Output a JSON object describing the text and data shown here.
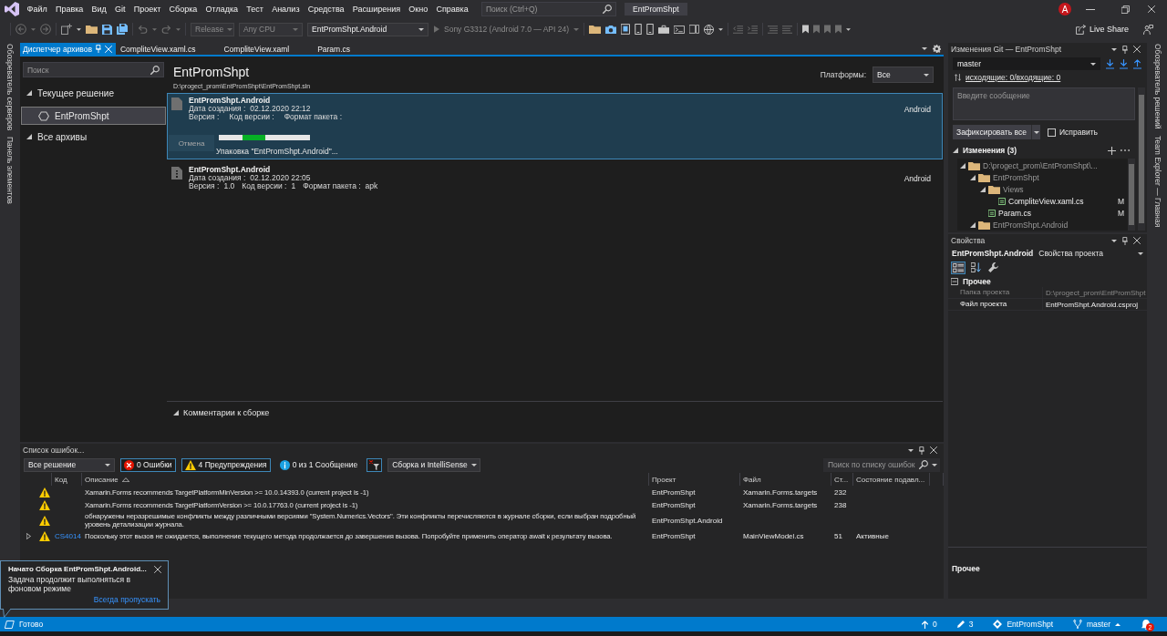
{
  "title_bar": {
    "menu": [
      "Файл",
      "Правка",
      "Вид",
      "Git",
      "Проект",
      "Сборка",
      "Отладка",
      "Тест",
      "Анализ",
      "Средства",
      "Расширения",
      "Окно",
      "Справка"
    ],
    "search": {
      "placeholder": "Поиск (Ctrl+Q)"
    },
    "solution_name": "EntPromShpt",
    "account_initial": "A"
  },
  "toolbar": {
    "left_groups": [
      [
        {
          "kind": "back",
          "disabled": true
        },
        {
          "kind": "dropdown",
          "disabled": true
        },
        {
          "kind": "forward",
          "disabled": true
        }
      ],
      [
        {
          "kind": "new_item",
          "disabled": false
        },
        {
          "kind": "dropdown",
          "disabled": false
        },
        {
          "kind": "open",
          "disabled": false
        },
        {
          "kind": "save",
          "disabled": false
        },
        {
          "kind": "save_all",
          "disabled": false
        }
      ],
      [
        {
          "kind": "undo",
          "disabled": true
        },
        {
          "kind": "dropdown",
          "disabled": true
        },
        {
          "kind": "redo",
          "disabled": true
        },
        {
          "kind": "dropdown",
          "disabled": true
        }
      ]
    ],
    "configuration": {
      "value": "Release",
      "disabled": true
    },
    "platform": {
      "value": "Any CPU",
      "disabled": true
    },
    "startup_project": {
      "value": "EntPromShpt.Android",
      "disabled": false
    },
    "device": {
      "label": "Sony G3312 (Android 7.0 — API 24)",
      "disabled": true
    },
    "right_groups": [
      [
        {
          "kind": "open",
          "disabled": false
        },
        {
          "kind": "camera",
          "disabled": false
        },
        {
          "kind": "tablet",
          "disabled": false
        },
        {
          "kind": "phone",
          "disabled": false
        },
        {
          "kind": "phone",
          "disabled": false
        },
        {
          "kind": "toolbox",
          "disabled": false
        },
        {
          "kind": "terminal",
          "disabled": false
        },
        {
          "kind": "panels",
          "disabled": false
        },
        {
          "kind": "globe",
          "disabled": false
        },
        {
          "kind": "dropdown",
          "disabled": false
        }
      ],
      [
        {
          "kind": "outdent",
          "disabled": true
        },
        {
          "kind": "indent",
          "disabled": true
        }
      ],
      [
        {
          "kind": "comment",
          "disabled": true
        },
        {
          "kind": "uncomment",
          "disabled": true
        }
      ],
      [
        {
          "kind": "bookmark",
          "disabled": false
        },
        {
          "kind": "bookmark",
          "disabled": true
        },
        {
          "kind": "bookmark",
          "disabled": true
        },
        {
          "kind": "bookmark",
          "disabled": true
        },
        {
          "kind": "dropdown",
          "disabled": false
        }
      ]
    ],
    "live_share": "Live Share"
  },
  "left_strip": [
    {
      "label": "Обозреватель серверов"
    },
    {
      "label": "Панель элементов"
    }
  ],
  "document_tabs": [
    {
      "label": "Диспетчер архивов",
      "selected": true
    },
    {
      "label": "CompliteView.xaml.cs",
      "selected": false
    },
    {
      "label": "CompliteView.xaml",
      "selected": false
    },
    {
      "label": "Param.cs",
      "selected": false
    }
  ],
  "archive_manager": {
    "search": {
      "placeholder": "Поиск"
    },
    "tree": [
      {
        "label": "Текущее решение",
        "expanded": true,
        "selected": false,
        "children": [
          {
            "label": "EntPromShpt",
            "selected": true
          }
        ]
      },
      {
        "label": "Все архивы",
        "expanded": true,
        "selected": false
      }
    ],
    "solution": {
      "name": "EntPromShpt",
      "path": "D:\\progect_prom\\EntPromShpt\\EntPromShpt.sln"
    },
    "platforms": {
      "label": "Платформы:",
      "value": "Все"
    },
    "archives": [
      {
        "kind": "pending",
        "selected": true,
        "name": "EntPromShpt.Android",
        "created": {
          "label": "Дата создания :",
          "value": "02.12.2020 22:12"
        },
        "fields": [
          {
            "label": "Версия :"
          },
          {
            "label": "Код версии :"
          },
          {
            "label": "Формат пакета :"
          }
        ],
        "platform": "Android",
        "progress": {
          "cancel": "Отмена",
          "indeterminate": true,
          "status": "Упаковка \"EntPromShpt.Android\"..."
        }
      },
      {
        "kind": "archive",
        "selected": false,
        "name": "EntPromShpt.Android",
        "created": {
          "label": "Дата создания :",
          "value": "02.12.2020 22:05"
        },
        "fields": [
          {
            "label": "Версия :",
            "value": "1.0"
          },
          {
            "label": "Код версии :",
            "value": "1"
          },
          {
            "label": "Формат пакета :",
            "value": "apk"
          }
        ],
        "platform": "Android"
      }
    ],
    "comments": {
      "label": "Комментарии к сборке",
      "expanded": true
    }
  },
  "error_list": {
    "title": "Список ошибок...",
    "scope": "Все решение",
    "filters": [
      {
        "kind": "error",
        "label": "0 Ошибки",
        "selected": true
      },
      {
        "kind": "warning",
        "label": "4 Предупреждения",
        "selected": true
      },
      {
        "kind": "info",
        "label": "0 из 1 Сообщение",
        "selected": false
      }
    ],
    "project_filter": {
      "selected": true
    },
    "source": "Сборка и IntelliSense",
    "search": {
      "placeholder": "Поиск по списку ошибок"
    },
    "columns": [
      {
        "label": "Код",
        "sorted_ascending": false
      },
      {
        "label": "Описание",
        "sorted_ascending": true
      },
      {
        "label": "Проект",
        "sorted_ascending": false
      },
      {
        "label": "Файл",
        "sorted_ascending": false
      },
      {
        "label": "Ст...",
        "sorted_ascending": false
      },
      {
        "label": "Состояние подавл...",
        "sorted_ascending": false
      }
    ],
    "rows": [
      {
        "kind": "warning",
        "expandable": false,
        "description": "Xamarin.Forms recommends TargetPlatformMinVersion >= 10.0.14393.0 (current project is -1)",
        "project": "EntPromShpt",
        "file": "Xamarin.Forms.targets",
        "line": "232"
      },
      {
        "kind": "warning",
        "expandable": false,
        "description": "Xamarin.Forms recommends TargetPlatformVersion >= 10.0.17763.0 (current project is -1)",
        "project": "EntPromShpt",
        "file": "Xamarin.Forms.targets",
        "line": "238"
      },
      {
        "kind": "warning",
        "expandable": false,
        "description": "обнаружены неразрешимые конфликты между различными версиями \"System.Numerics.Vectors\". Эти конфликты перечисляются в журнале сборки, если выбран подробный уровень детализации журнала.",
        "project": "EntPromShpt.Android"
      },
      {
        "kind": "warning",
        "expandable": true,
        "code": "CS4014",
        "description": "Поскольку этот вызов не ожидается, выполнение текущего метода продолжается до завершения вызова. Попробуйте применить оператор await к результату вызова.",
        "project": "EntPromShpt",
        "file": "MainViewModel.cs",
        "line": "51",
        "state": "Активные"
      }
    ]
  },
  "toast": {
    "title": "Начато Сборка EntPromShpt.Android...",
    "body": "Задача продолжит выполняться в фоновом режиме",
    "link": "Всегда пропускать"
  },
  "git_changes": {
    "title": "Изменения Git — EntPromShpt",
    "branch": "master",
    "sync_link": "исходящие: 0/входящие: 0",
    "message": {
      "placeholder": "Введите сообщение"
    },
    "commit_button": "Зафиксировать все",
    "amend": {
      "label": "Исправить",
      "checked": false
    },
    "changes": {
      "label": "Изменения (3)",
      "expanded": true,
      "tree": [
        {
          "label": "D:\\progect_prom\\EntPromShpt\\...",
          "kind": "folder",
          "expanded": true,
          "children": [
            {
              "label": "EntPromShpt",
              "kind": "folder",
              "expanded": true,
              "children": [
                {
                  "label": "Views",
                  "kind": "folder",
                  "expanded": true,
                  "children": [
                    {
                      "label": "CompliteView.xaml.cs",
                      "kind": "csharp",
                      "status": "M"
                    }
                  ]
                },
                {
                  "label": "Param.cs",
                  "kind": "csharp",
                  "status": "M"
                }
              ]
            },
            {
              "label": "EntPromShpt.Android",
              "kind": "folder",
              "expanded": true
            }
          ]
        }
      ]
    }
  },
  "properties": {
    "title": "Свойства",
    "object": "EntPromShpt.Android",
    "object_type": "Свойства проекта",
    "toolbar": [
      {
        "kind": "categorized",
        "selected": true
      },
      {
        "kind": "alphabetical",
        "selected": false
      },
      {
        "kind": "property_pages",
        "selected": false
      }
    ],
    "categories": [
      {
        "label": "Прочее",
        "expanded": true,
        "rows": [
          {
            "name": "Папка проекта",
            "value": "D:\\progect_prom\\EntPromShpt",
            "readonly": true
          },
          {
            "name": "Файл проекта",
            "value": "EntPromShpt.Android.csproj",
            "readonly": false
          }
        ]
      }
    ],
    "description": {
      "title": "Прочее"
    }
  },
  "right_strip": [
    {
      "label": "Обозреватель решений"
    },
    {
      "label": "Team Explorer — Главная"
    }
  ],
  "status_bar": {
    "text": "Готово",
    "outgoing": "0",
    "changes": "3",
    "repository": "EntPromShpt",
    "branch": "master",
    "notifications": "2"
  }
}
